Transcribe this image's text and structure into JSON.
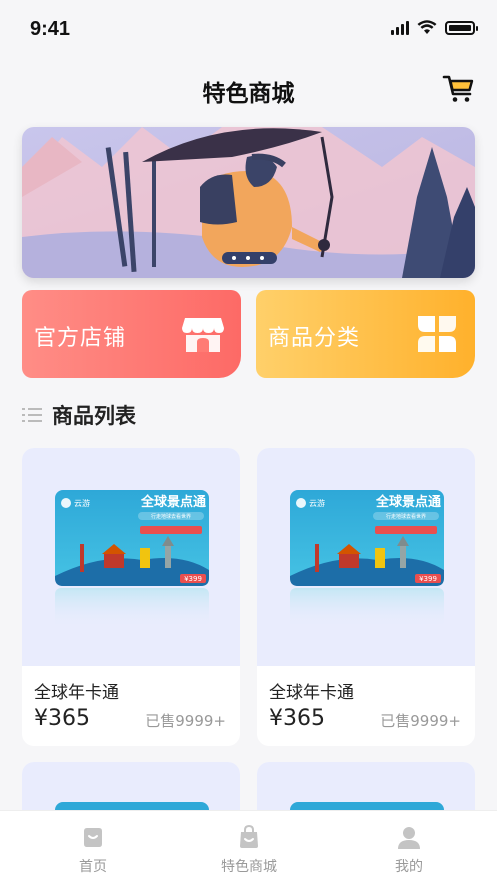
{
  "status_bar": {
    "time": "9:41"
  },
  "nav": {
    "title": "特色商城"
  },
  "shortcuts": {
    "official_store": "官方店铺",
    "categories": "商品分类"
  },
  "section": {
    "title": "商品列表"
  },
  "products": [
    {
      "name": "全球年卡通",
      "price": "¥365",
      "sold": "已售9999+",
      "card_title": "全球景点通",
      "card_subtitle": "行走地球去看世界",
      "card_brand": "云游",
      "card_price_tag": "¥399"
    },
    {
      "name": "全球年卡通",
      "price": "¥365",
      "sold": "已售9999+",
      "card_title": "全球景点通",
      "card_subtitle": "行走地球去看世界",
      "card_brand": "云游",
      "card_price_tag": "¥399"
    }
  ],
  "tab_bar": {
    "items": [
      {
        "label": "首页",
        "icon": "home-icon"
      },
      {
        "label": "特色商城",
        "icon": "shopping-bag-icon"
      },
      {
        "label": "我的",
        "icon": "user-icon"
      }
    ]
  },
  "colors": {
    "official_store_bg": "#fd6a66",
    "categories_bg": "#ffb12c",
    "product_image_bg": "#e9ecfd",
    "tab_inactive": "#9a9a9a"
  }
}
